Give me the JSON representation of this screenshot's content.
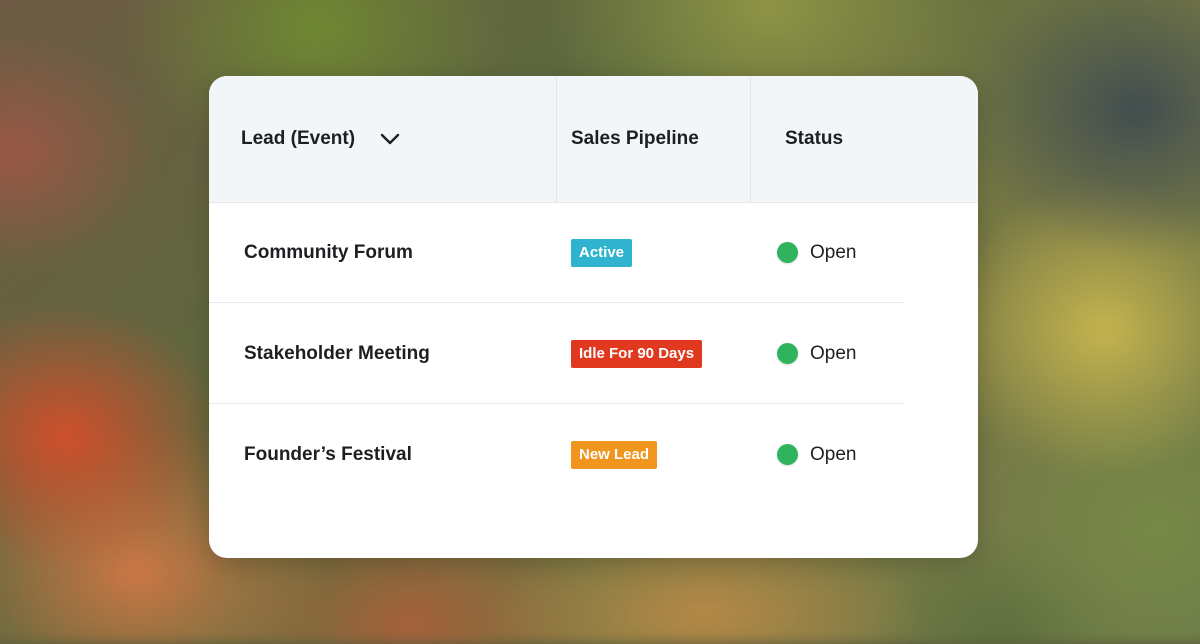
{
  "table": {
    "columns": [
      {
        "label": "Lead (Event)",
        "icon": "chevron-down-icon"
      },
      {
        "label": "Sales Pipeline"
      },
      {
        "label": "Status"
      }
    ],
    "rows": [
      {
        "lead": "Community Forum",
        "pipeline": "Active",
        "pipeline_color": "#2fb3cf",
        "status": "Open",
        "status_color": "#2fb35c"
      },
      {
        "lead": "Stakeholder Meeting",
        "pipeline": "Idle For 90 Days",
        "pipeline_color": "#e0391f",
        "status": "Open",
        "status_color": "#2fb35c"
      },
      {
        "lead": "Founder’s Festival",
        "pipeline": "New Lead",
        "pipeline_color": "#f0951e",
        "status": "Open",
        "status_color": "#2fb35c"
      }
    ]
  }
}
